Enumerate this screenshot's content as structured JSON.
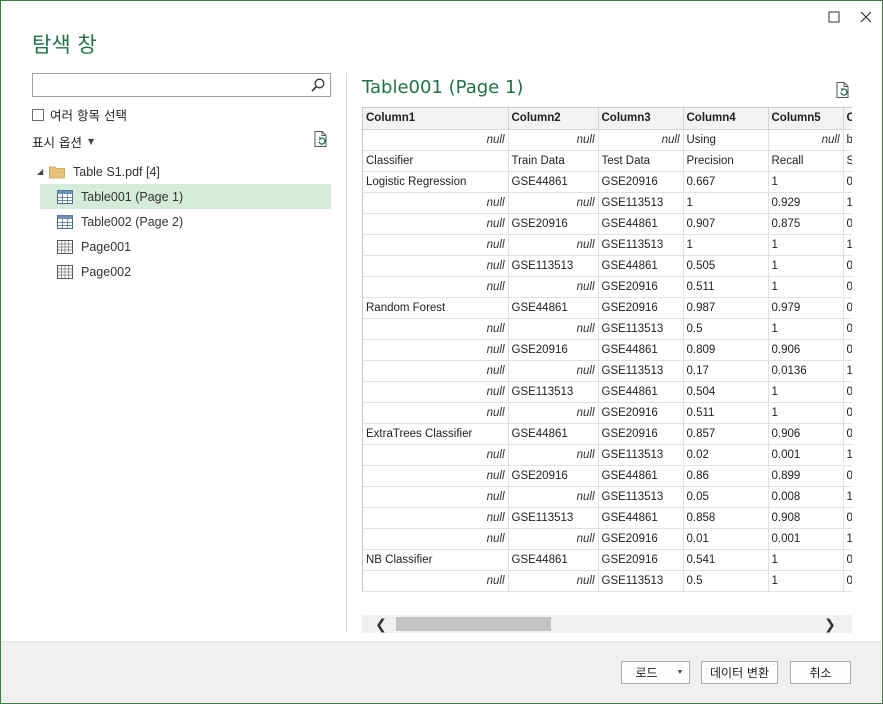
{
  "window": {
    "title": "탐색 창",
    "maximize_glyph": "☐",
    "close_glyph": "✕"
  },
  "left": {
    "search_placeholder": "",
    "search_value": "",
    "multi_select_label": "여러 항목 선택",
    "display_options_label": "표시 옵션",
    "tree": [
      {
        "label": "Table S1.pdf [4]",
        "type": "folder"
      },
      {
        "label": "Table001 (Page 1)",
        "type": "table",
        "selected": true
      },
      {
        "label": "Table002 (Page 2)",
        "type": "table"
      },
      {
        "label": "Page001",
        "type": "page"
      },
      {
        "label": "Page002",
        "type": "page"
      }
    ]
  },
  "preview": {
    "title": "Table001 (Page 1)",
    "columns": [
      "Column1",
      "Column2",
      "Column3",
      "Column4",
      "Column5",
      "C"
    ],
    "rows": [
      [
        "null",
        "null",
        "null",
        "Using",
        "null",
        "b"
      ],
      [
        "Classifier",
        "Train Data",
        "Test Data",
        "Precision",
        "Recall",
        "S"
      ],
      [
        "Logistic Regression",
        "GSE44861",
        "GSE20916",
        "0.667",
        "1",
        "0"
      ],
      [
        "null",
        "null",
        "GSE113513",
        "1",
        "0.929",
        "1"
      ],
      [
        "null",
        "GSE20916",
        "GSE44861",
        "0.907",
        "0.875",
        "0"
      ],
      [
        "null",
        "null",
        "GSE113513",
        "1",
        "1",
        "1"
      ],
      [
        "null",
        "GSE113513",
        "GSE44861",
        "0.505",
        "1",
        "0"
      ],
      [
        "null",
        "null",
        "GSE20916",
        "0.511",
        "1",
        "0"
      ],
      [
        "Random Forest",
        "GSE44861",
        "GSE20916",
        "0.987",
        "0.979",
        "0"
      ],
      [
        "null",
        "null",
        "GSE113513",
        "0.5",
        "1",
        "0"
      ],
      [
        "null",
        "GSE20916",
        "GSE44861",
        "0.809",
        "0.906",
        "0"
      ],
      [
        "null",
        "null",
        "GSE113513",
        "0.17",
        "0.0136",
        "1"
      ],
      [
        "null",
        "GSE113513",
        "GSE44861",
        "0.504",
        "1",
        "0"
      ],
      [
        "null",
        "null",
        "GSE20916",
        "0.511",
        "1",
        "0"
      ],
      [
        "ExtraTrees Classifier",
        "GSE44861",
        "GSE20916",
        "0.857",
        "0.906",
        "0"
      ],
      [
        "null",
        "null",
        "GSE113513",
        "0.02",
        "0.001",
        "1"
      ],
      [
        "null",
        "GSE20916",
        "GSE44861",
        "0.86",
        "0.899",
        "0"
      ],
      [
        "null",
        "null",
        "GSE113513",
        "0.05",
        "0.008",
        "1"
      ],
      [
        "null",
        "GSE113513",
        "GSE44861",
        "0.858",
        "0.908",
        "0"
      ],
      [
        "null",
        "null",
        "GSE20916",
        "0.01",
        "0.001",
        "1"
      ],
      [
        "NB Classifier",
        "GSE44861",
        "GSE20916",
        "0.541",
        "1",
        "0"
      ],
      [
        "null",
        "null",
        "GSE113513",
        "0.5",
        "1",
        "0"
      ]
    ]
  },
  "footer": {
    "load_label": "로드",
    "transform_label": "데이터 변환",
    "cancel_label": "취소"
  },
  "colors": {
    "accent": "#217346",
    "selected_bg": "#d5ecdb"
  }
}
